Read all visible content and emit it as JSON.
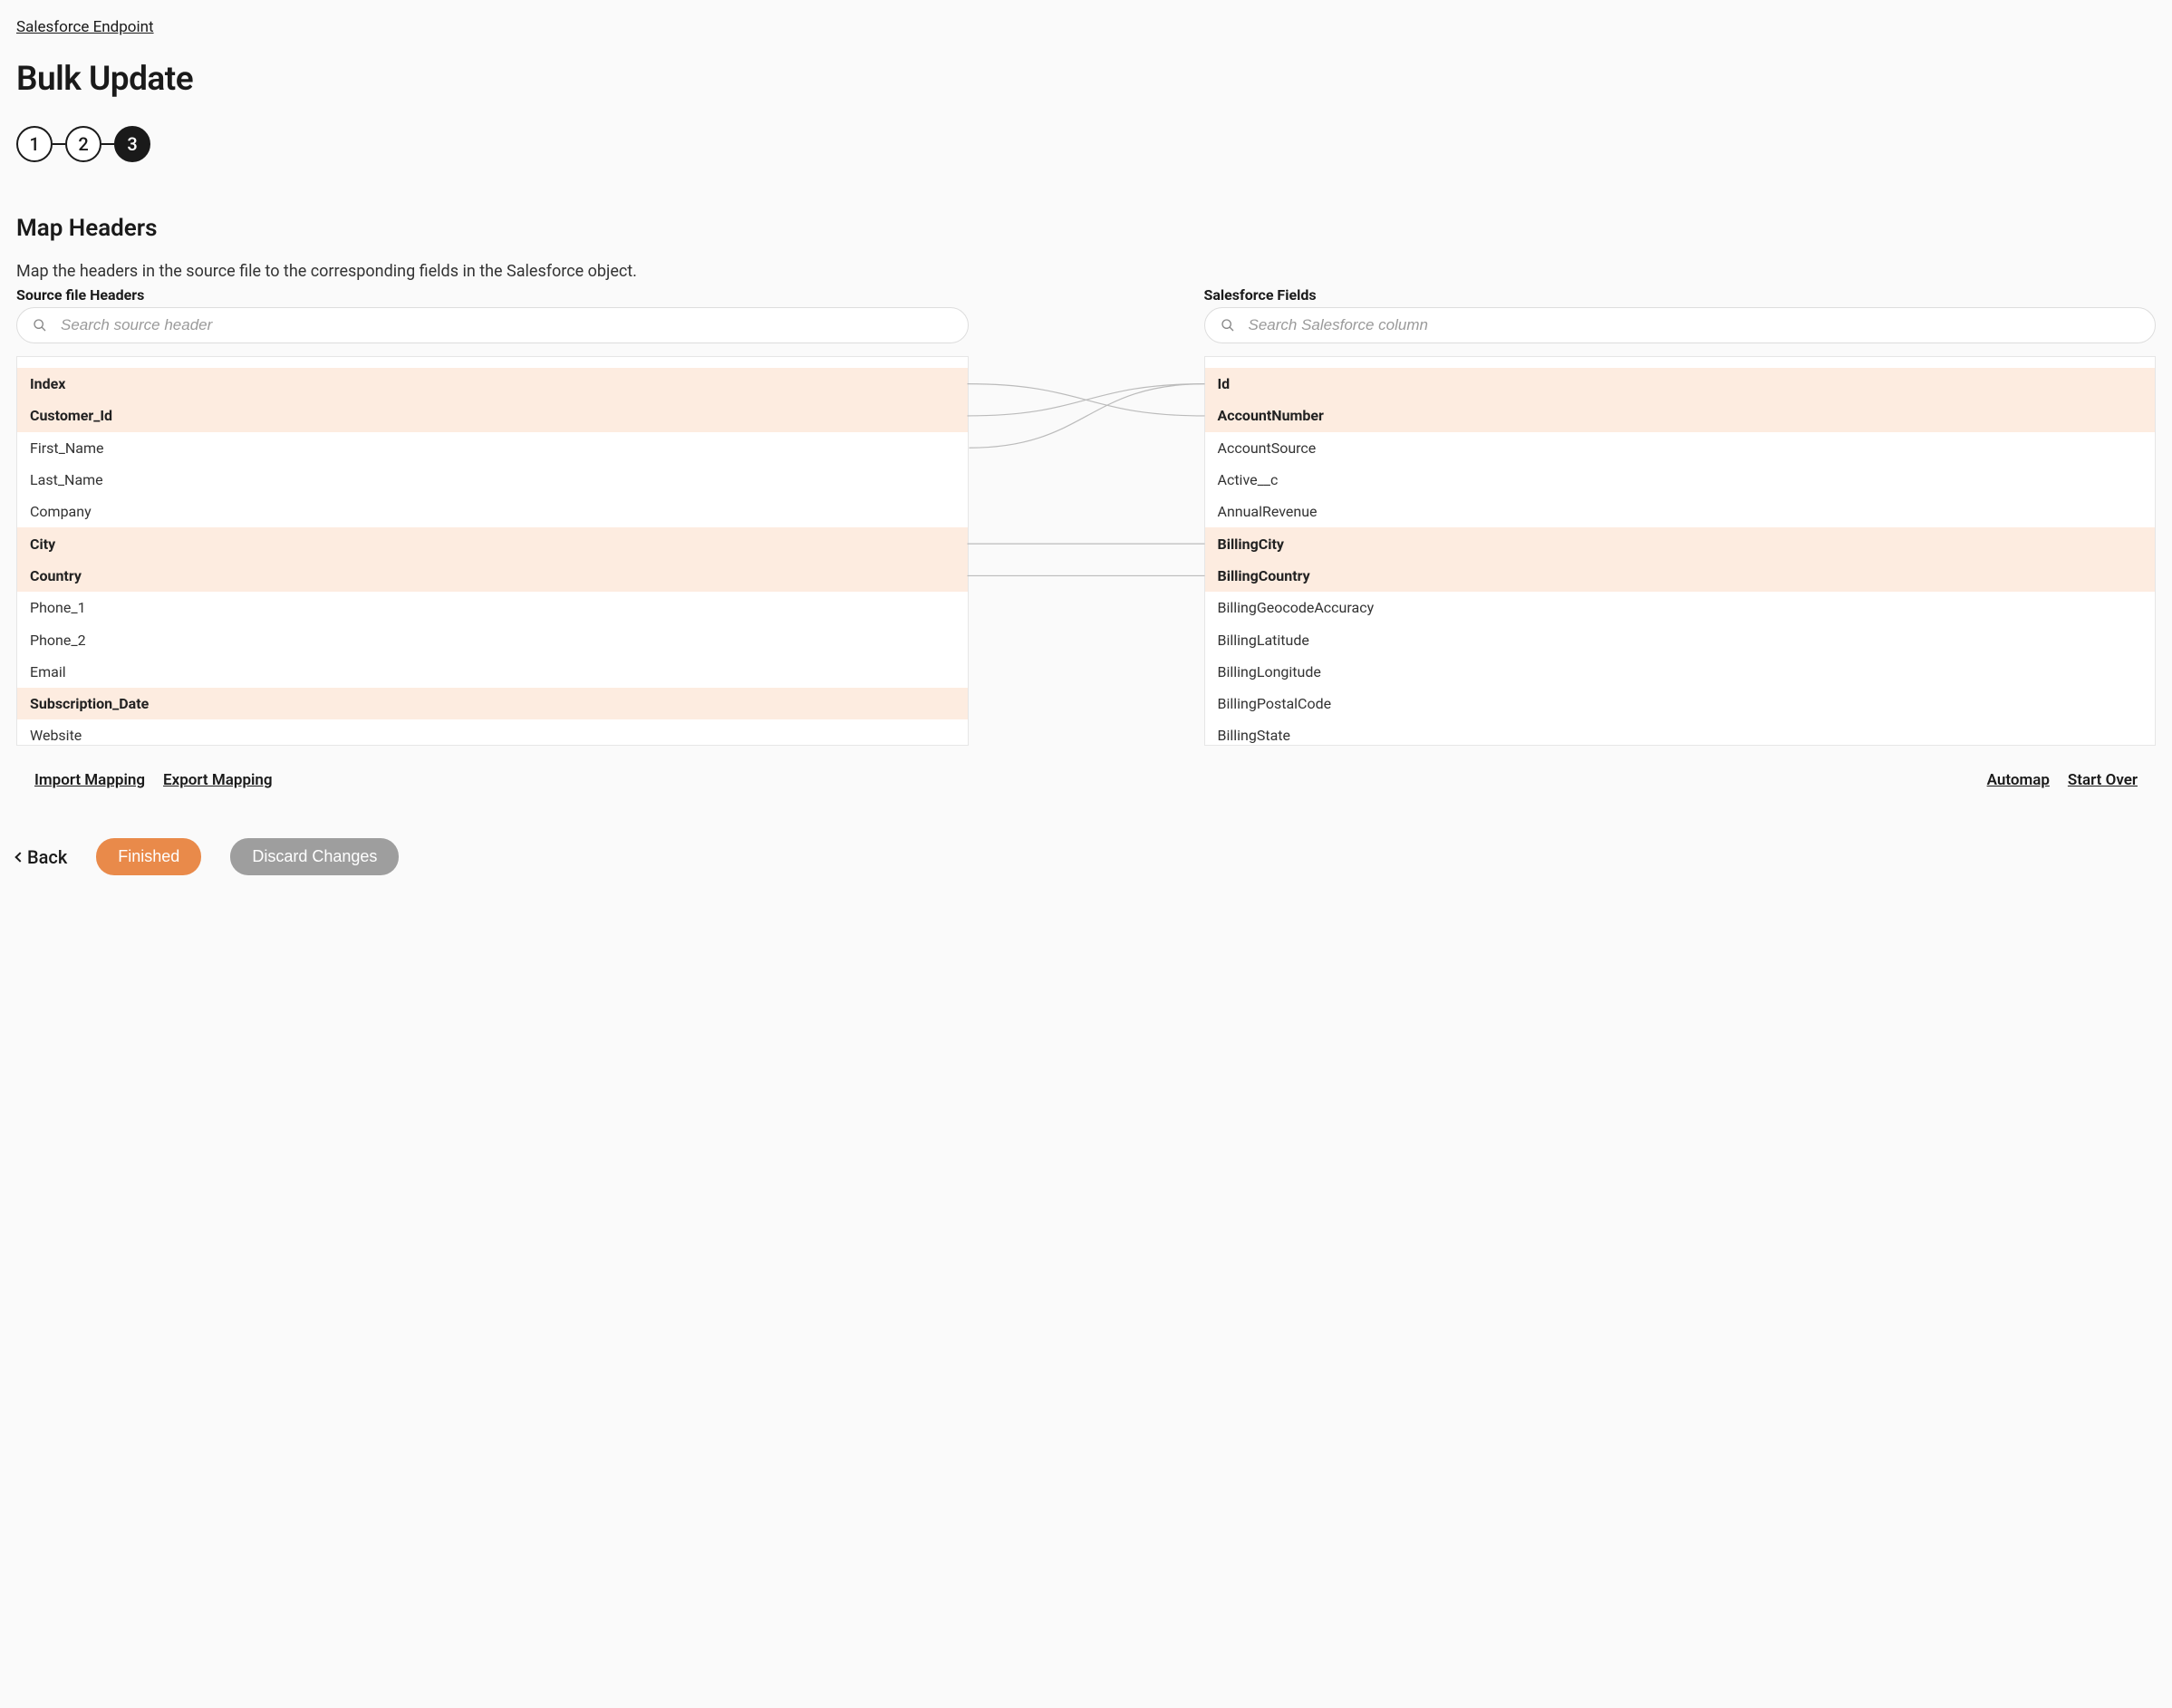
{
  "breadcrumb": {
    "label": "Salesforce Endpoint"
  },
  "title": "Bulk Update",
  "stepper": {
    "steps": [
      "1",
      "2",
      "3"
    ],
    "active_index": 2
  },
  "section": {
    "title": "Map Headers",
    "description": "Map the headers in the source file to the corresponding fields in the Salesforce object."
  },
  "left": {
    "label": "Source file Headers",
    "search_placeholder": "Search source header",
    "items": [
      {
        "label": "Index",
        "mapped": true
      },
      {
        "label": "Customer_Id",
        "mapped": true
      },
      {
        "label": "First_Name",
        "mapped": false
      },
      {
        "label": "Last_Name",
        "mapped": false
      },
      {
        "label": "Company",
        "mapped": false
      },
      {
        "label": "City",
        "mapped": true
      },
      {
        "label": "Country",
        "mapped": true
      },
      {
        "label": "Phone_1",
        "mapped": false
      },
      {
        "label": "Phone_2",
        "mapped": false
      },
      {
        "label": "Email",
        "mapped": false
      },
      {
        "label": "Subscription_Date",
        "mapped": true
      },
      {
        "label": "Website",
        "mapped": false
      }
    ]
  },
  "right": {
    "label": "Salesforce Fields",
    "search_placeholder": "Search Salesforce column",
    "items": [
      {
        "label": "Id",
        "mapped": true
      },
      {
        "label": "AccountNumber",
        "mapped": true
      },
      {
        "label": "AccountSource",
        "mapped": false
      },
      {
        "label": "Active__c",
        "mapped": false
      },
      {
        "label": "AnnualRevenue",
        "mapped": false
      },
      {
        "label": "BillingCity",
        "mapped": true
      },
      {
        "label": "BillingCountry",
        "mapped": true
      },
      {
        "label": "BillingGeocodeAccuracy",
        "mapped": false
      },
      {
        "label": "BillingLatitude",
        "mapped": false
      },
      {
        "label": "BillingLongitude",
        "mapped": false
      },
      {
        "label": "BillingPostalCode",
        "mapped": false
      },
      {
        "label": "BillingState",
        "mapped": false
      }
    ]
  },
  "mappings": [
    {
      "from": 0,
      "to": 1
    },
    {
      "from": 1,
      "to": 0
    },
    {
      "from": 2,
      "to": 0,
      "offset_left": true
    },
    {
      "from": 5,
      "to": 5
    },
    {
      "from": 6,
      "to": 6
    }
  ],
  "links": {
    "import": "Import Mapping",
    "export": "Export Mapping",
    "automap": "Automap",
    "startover": "Start Over"
  },
  "footer": {
    "back": "Back",
    "finished": "Finished",
    "discard": "Discard Changes"
  }
}
